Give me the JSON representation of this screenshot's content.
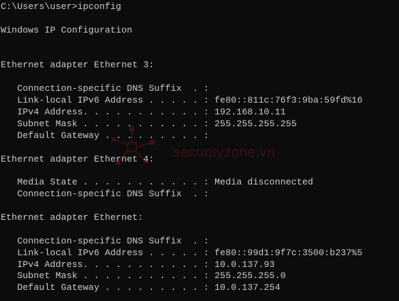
{
  "terminal": {
    "lines": [
      "C:\\Users\\user>ipconfig",
      "",
      "Windows IP Configuration",
      "",
      "",
      "Ethernet adapter Ethernet 3:",
      "",
      "   Connection-specific DNS Suffix  . :",
      "   Link-local IPv6 Address . . . . . : fe80::811c:76f3:9ba:59fd%16",
      "   IPv4 Address. . . . . . . . . . . : 192.168.10.11",
      "   Subnet Mask . . . . . . . . . . . : 255.255.255.255",
      "   Default Gateway . . . . . . . . . :",
      "",
      "Ethernet adapter Ethernet 4:",
      "",
      "   Media State . . . . . . . . . . . : Media disconnected",
      "   Connection-specific DNS Suffix  . :",
      "",
      "Ethernet adapter Ethernet:",
      "",
      "   Connection-specific DNS Suffix  . :",
      "   Link-local IPv6 Address . . . . . : fe80::99d1:9f7c:3500:b237%5",
      "   IPv4 Address. . . . . . . . . . . : 10.0.137.93",
      "   Subnet Mask . . . . . . . . . . . : 255.255.255.0",
      "   Default Gateway . . . . . . . . . : 10.0.137.254"
    ]
  },
  "watermark": {
    "text": "securityzone.vn",
    "color": "#e0262b",
    "icon": "securityzone-logo-icon"
  },
  "colors": {
    "background": "#0c0c0c",
    "text": "#cccccc"
  }
}
